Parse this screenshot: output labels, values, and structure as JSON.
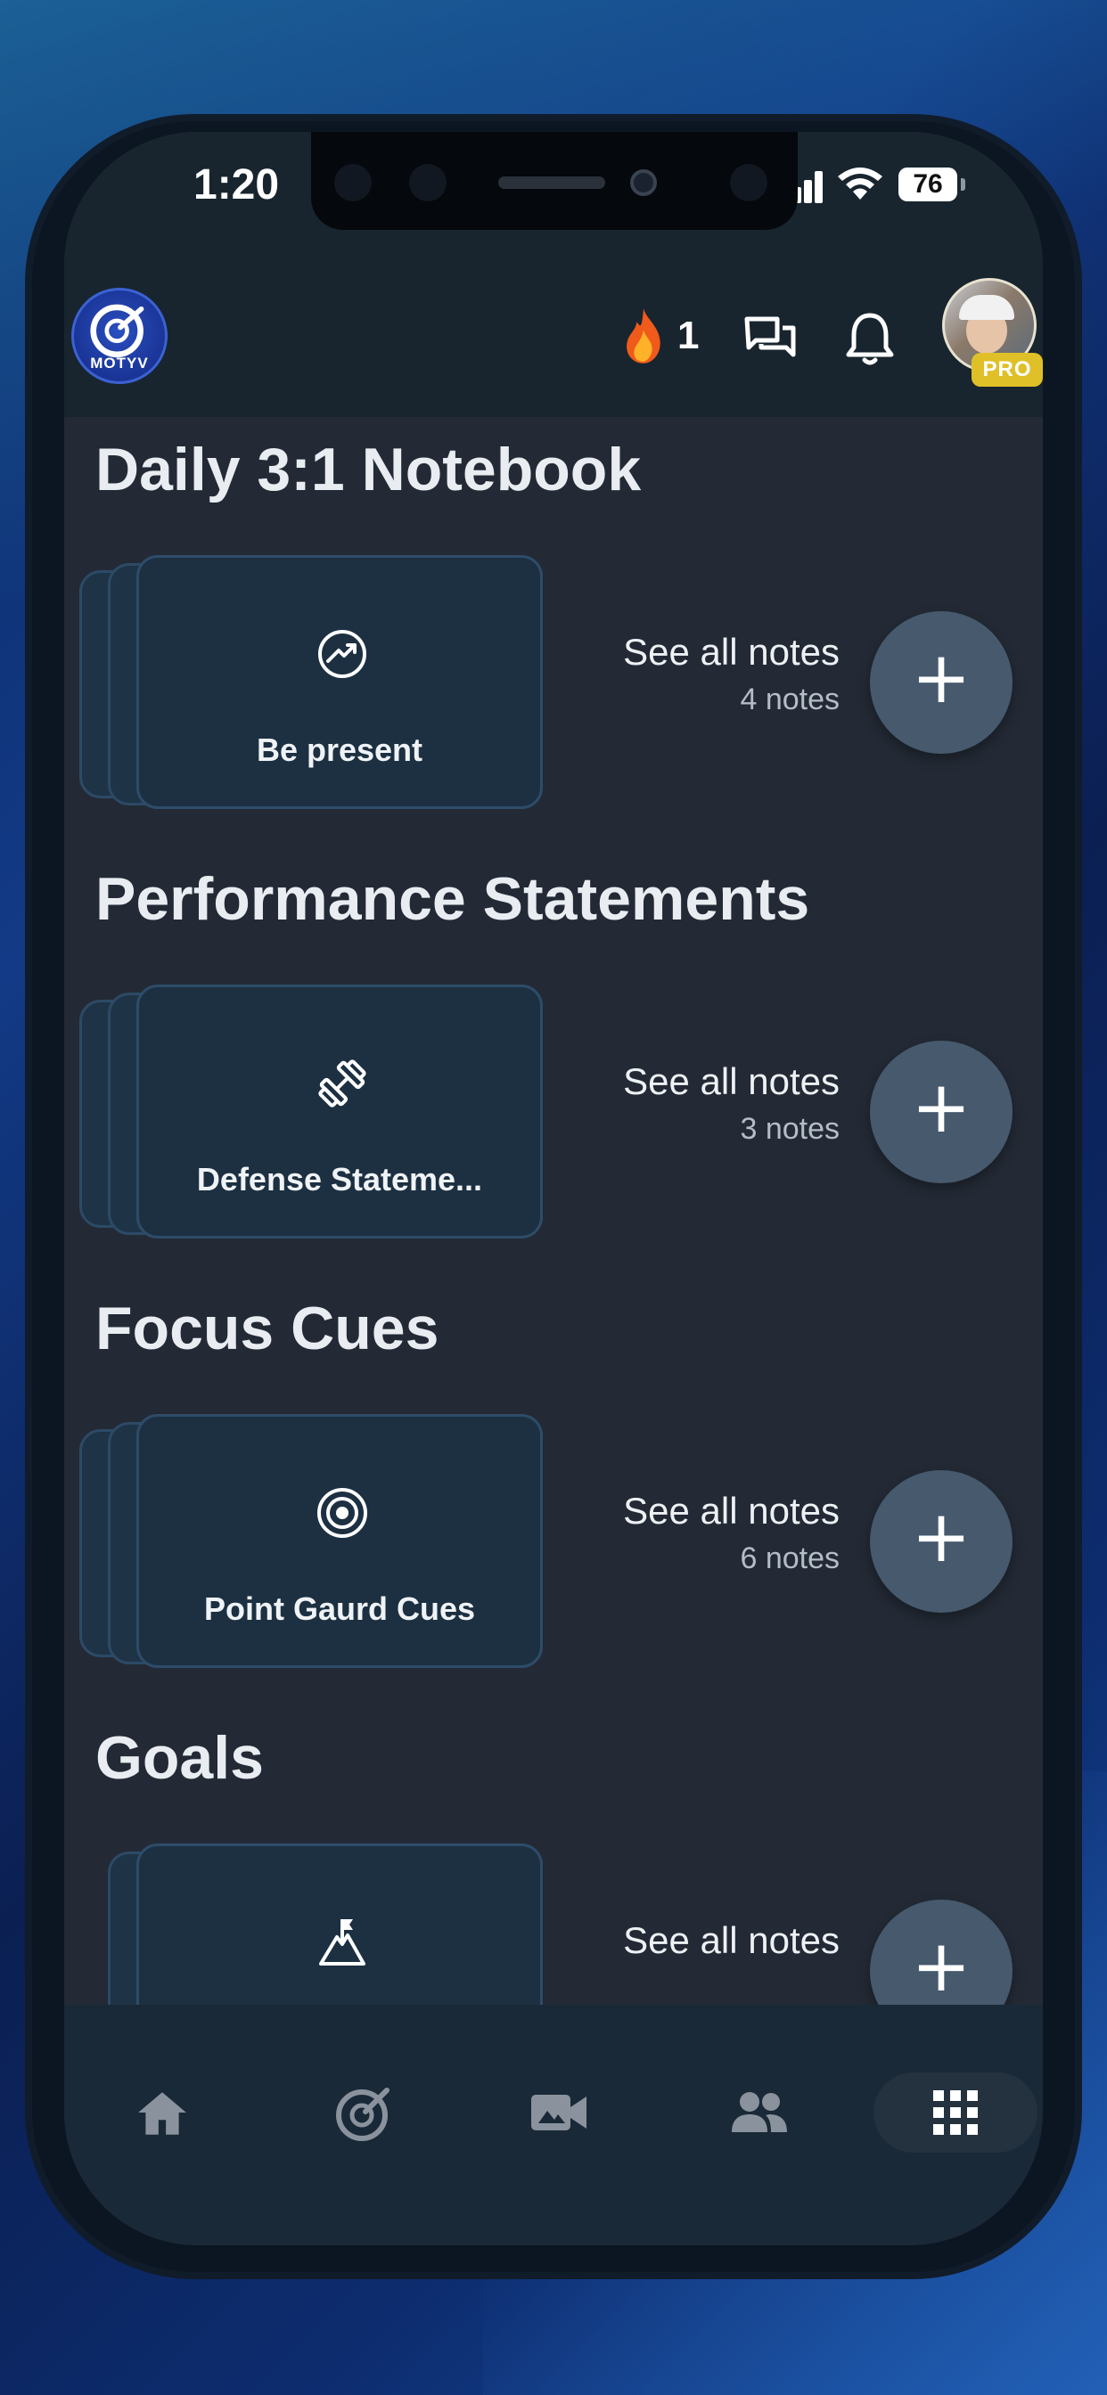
{
  "status_bar": {
    "time": "1:20",
    "battery": "76"
  },
  "header": {
    "logo_text": "MOTYV",
    "streak_count": "1",
    "pro_badge": "PRO",
    "icons": [
      "flame-icon",
      "chat-icon",
      "bell-icon",
      "avatar"
    ]
  },
  "sections": [
    {
      "title": "Daily 3:1 Notebook",
      "card_label": "Be present",
      "card_icon": "trend-up-icon",
      "see_all_label": "See all notes",
      "note_count": "4 notes",
      "stack": 3
    },
    {
      "title": "Performance Statements",
      "card_label": "Defense Stateme...",
      "card_icon": "dumbbell-icon",
      "see_all_label": "See all notes",
      "note_count": "3 notes",
      "stack": 3
    },
    {
      "title": "Focus Cues",
      "card_label": "Point Gaurd Cues",
      "card_icon": "target-icon",
      "see_all_label": "See all notes",
      "note_count": "6 notes",
      "stack": 3
    },
    {
      "title": "Goals",
      "card_label": "",
      "card_icon": "mountain-flag-icon",
      "see_all_label": "See all notes",
      "note_count": "",
      "stack": 2
    }
  ],
  "fab_symbol": "+",
  "bottom_nav": {
    "items": [
      "home-icon",
      "motyv-logo-icon",
      "video-camera-icon",
      "people-icon",
      "grid-icon"
    ],
    "active": "grid-icon"
  },
  "colors": {
    "background": "#232a35",
    "header": "#18252f",
    "card": "#1c3042",
    "card_border": "#2e4c69",
    "fab": "#46596d",
    "pro_badge": "#e0c028"
  }
}
